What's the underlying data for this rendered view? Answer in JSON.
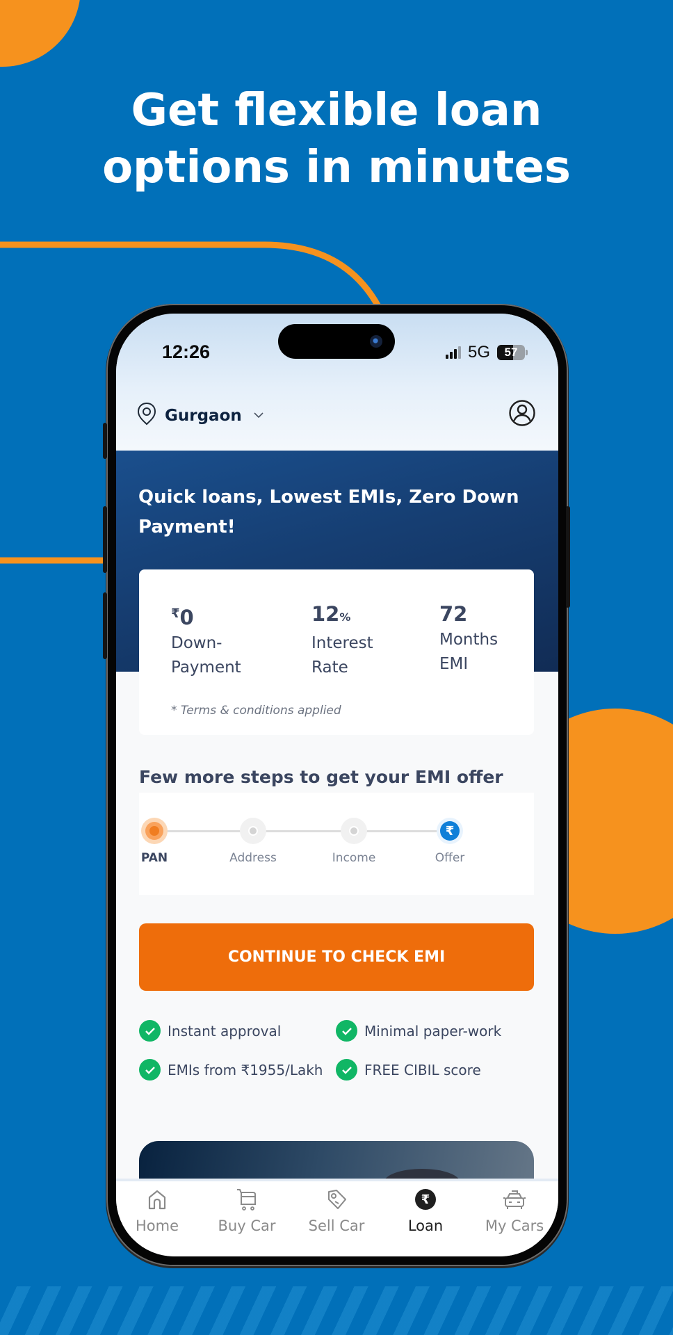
{
  "headline": {
    "line1": "Get flexible loan",
    "line2": "options in minutes"
  },
  "colors": {
    "background": "#0170b9",
    "decor_orange": "#f6921e",
    "cta_orange": "#ee6d0b",
    "hero_navy": "#163e72",
    "check_green": "#10b665",
    "offer_blue": "#0f7fd8"
  },
  "status_bar": {
    "time": "12:26",
    "network": "5G",
    "battery_level": "57",
    "battery_percent": 57,
    "signal_bars_active": 3,
    "signal_bars_total": 4
  },
  "header": {
    "location_icon": "location-pin-icon",
    "location": "Gurgaon",
    "dropdown_icon": "chevron-down-icon",
    "profile_icon": "user-profile-icon"
  },
  "hero": {
    "title": "Quick loans, Lowest EMIs, Zero Down Payment!"
  },
  "stats": [
    {
      "currency": "₹",
      "value": "0",
      "unit": "",
      "label_line1": "Down-",
      "label_line2": "Payment"
    },
    {
      "currency": "",
      "value": "12",
      "unit": "%",
      "label_line1": "Interest",
      "label_line2": "Rate"
    },
    {
      "currency": "",
      "value": "72",
      "unit": "",
      "label_line1": "Months",
      "label_line2": "EMI"
    }
  ],
  "terms": "* Terms & conditions applied",
  "steps": {
    "title": "Few more steps to get your EMI offer",
    "items": [
      {
        "label": "PAN",
        "state": "active"
      },
      {
        "label": "Address",
        "state": "pending"
      },
      {
        "label": "Income",
        "state": "pending"
      },
      {
        "label": "Offer",
        "state": "final",
        "icon": "rupee-icon"
      }
    ]
  },
  "cta": {
    "label": "CONTINUE TO CHECK EMI"
  },
  "features": [
    {
      "icon": "check-circle-icon",
      "text": "Instant approval"
    },
    {
      "icon": "check-circle-icon",
      "text": "Minimal paper-work"
    },
    {
      "icon": "check-circle-icon",
      "text": "EMIs from ₹1955/Lakh"
    },
    {
      "icon": "check-circle-icon",
      "text": "FREE CIBIL score"
    }
  ],
  "bottom_nav": {
    "items": [
      {
        "label": "Home",
        "icon": "home-icon",
        "active": false
      },
      {
        "label": "Buy Car",
        "icon": "cart-icon",
        "active": false
      },
      {
        "label": "Sell Car",
        "icon": "price-tag-icon",
        "active": false
      },
      {
        "label": "Loan",
        "icon": "rupee-icon",
        "active": true
      },
      {
        "label": "My Cars",
        "icon": "car-icon",
        "active": false
      }
    ]
  }
}
